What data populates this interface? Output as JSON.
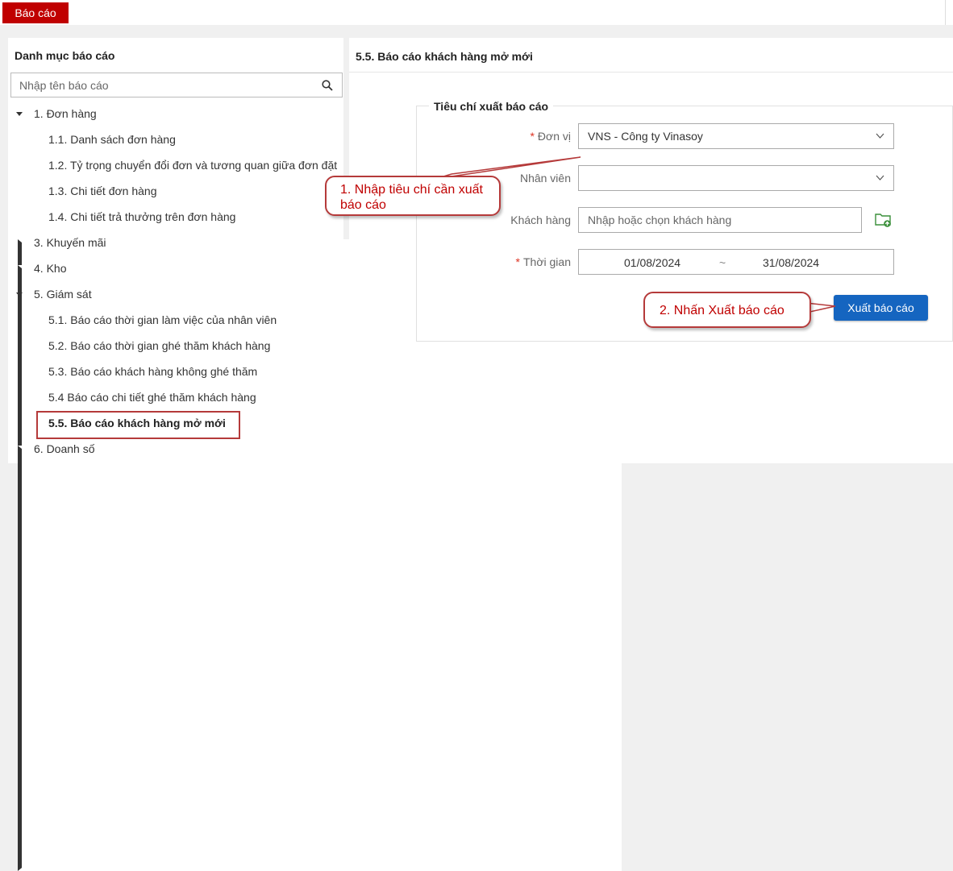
{
  "topbar": {
    "tab_label": "Báo cáo"
  },
  "left_panel": {
    "heading": "Danh mục báo cáo",
    "search_placeholder": "Nhập tên báo cáo",
    "items": [
      {
        "label": "1. Đơn hàng",
        "expanded": true
      },
      {
        "label": "1.1. Danh sách đơn hàng"
      },
      {
        "label": "1.2. Tỷ trọng chuyển đổi đơn và tương quan giữa đơn đặt"
      },
      {
        "label": "1.3. Chi tiết đơn hàng"
      },
      {
        "label": "1.4. Chi tiết trả thưởng trên đơn hàng"
      },
      {
        "label": "3. Khuyến mãi",
        "expanded": false
      },
      {
        "label": "4. Kho",
        "expanded": false
      },
      {
        "label": "5. Giám sát",
        "expanded": true
      },
      {
        "label": "5.1. Báo cáo thời gian làm việc của nhân viên"
      },
      {
        "label": "5.2. Báo cáo thời gian ghé thăm khách hàng"
      },
      {
        "label": "5.3. Báo cáo khách hàng không ghé thăm"
      },
      {
        "label": "5.4 Báo cáo chi tiết ghé thăm khách hàng"
      },
      {
        "label": "5.5. Báo cáo khách hàng mở mới",
        "selected": true
      },
      {
        "label": "6. Doanh số",
        "expanded": false
      }
    ]
  },
  "main": {
    "title": "5.5. Báo cáo khách hàng mở mới",
    "criteria_title": "Tiêu chí xuất báo cáo",
    "fields": {
      "unit": {
        "required_mark": "*",
        "label": "Đơn vị",
        "value": "VNS - Công ty Vinasoy"
      },
      "staff": {
        "label": "Nhân viên",
        "value": ""
      },
      "customer": {
        "label": "Khách hàng",
        "placeholder": "Nhập hoặc chọn khách hàng"
      },
      "period": {
        "required_mark": "*",
        "label": "Thời gian",
        "from": "01/08/2024",
        "separator": "~",
        "to": "31/08/2024"
      }
    },
    "export_button": "Xuất báo cáo"
  },
  "callouts": {
    "first": "1. Nhập tiêu chí cần xuất báo cáo",
    "second": "2. Nhấn Xuất báo cáo"
  },
  "colors": {
    "brand_red": "#c00000",
    "button_blue": "#1565c0",
    "callout_border": "#b53a3a"
  },
  "icons": [
    "search-icon",
    "chevron-down-icon",
    "folder-upload-icon",
    "caret-down-icon",
    "caret-right-icon"
  ]
}
